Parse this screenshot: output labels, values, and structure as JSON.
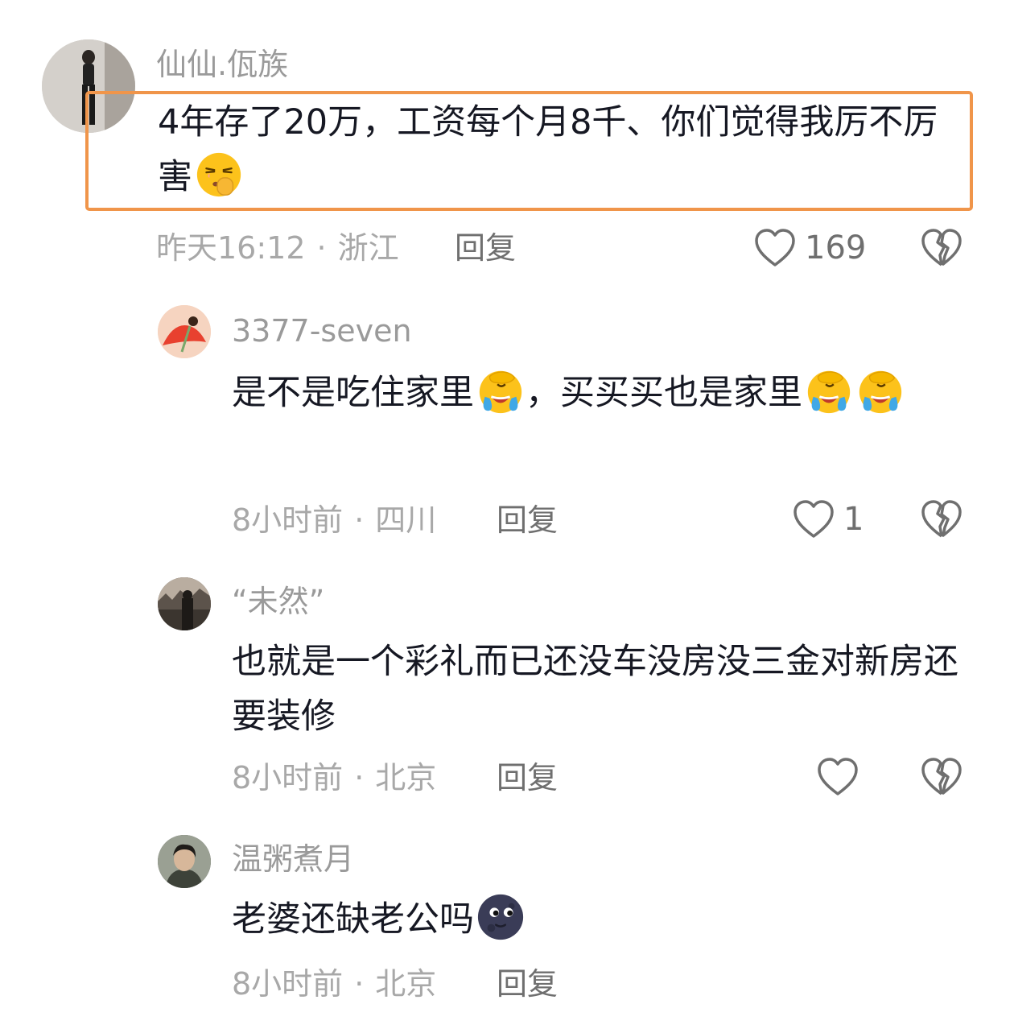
{
  "comments": [
    {
      "username": "仙仙.佤族",
      "text": "4年存了20万，工资每个月8千、你们觉得我厉不厉害",
      "emoji": "shushing-face-emoji",
      "time": "昨天16:12",
      "location": "浙江",
      "reply_label": "回复",
      "likes": "169"
    },
    {
      "username": "3377-seven",
      "text_part1": "是不是吃住家里",
      "text_part2": "，买买买也是家里",
      "emoji": "face-palm-crying-emoji",
      "time": "8小时前",
      "location": "四川",
      "reply_label": "回复",
      "likes": "1"
    },
    {
      "username": "“未然”",
      "text": "也就是一个彩礼而已还没车没房没三金对新房还要装修",
      "time": "8小时前",
      "location": "北京",
      "reply_label": "回复",
      "likes": ""
    },
    {
      "username": "温粥煮月",
      "text": "老婆还缺老公吗",
      "emoji": "new-moon-face-emoji",
      "time": "8小时前",
      "location": "北京",
      "reply_label": "回复"
    }
  ],
  "separator": "·",
  "colors": {
    "highlight_border": "#f0954a",
    "username": "#9a9a9a",
    "meta": "#a8a8a8",
    "text": "#161823"
  },
  "icons": {
    "like": "heart-outline-icon",
    "dislike": "broken-heart-icon"
  }
}
